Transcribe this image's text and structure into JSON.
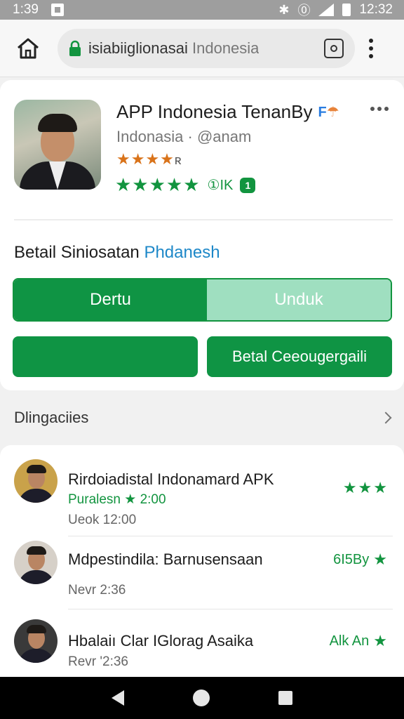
{
  "status_bar": {
    "time_left": "1:39",
    "time_right": "12:32"
  },
  "browser": {
    "url_main": "isiabiiglionasai",
    "url_domain": "Indonesia",
    "icons": [
      "home-icon",
      "lock-icon",
      "camera-icon",
      "more-vert-icon"
    ]
  },
  "app": {
    "title": "APP Indonesia TenanBy",
    "subtitle": "Indonasia · @anam",
    "orange_stars": "★★★★",
    "orange_suffix": "ʀ",
    "green_stars": "★★★★★",
    "count": "①IK",
    "badge": "1",
    "section_title_main": "Betail Siniosatan",
    "section_title_accent": "Phdanesh",
    "seg_left": "Dertu",
    "seg_right": "Unduk",
    "btn_left": "",
    "btn_right": "Betal Ceeougergaili",
    "colors": {
      "green": "#0f9444",
      "light_green": "#9fdfc0",
      "accent_blue": "#1e88c8",
      "orange": "#d9731a"
    }
  },
  "section": {
    "label": "Dlingaciies"
  },
  "list": [
    {
      "title": "Rirdoiadistal Indonamard APK",
      "meta": "Puralesn ★ 2:00",
      "time": "Ueok 12:00",
      "right_text": "",
      "right_stars": "★★★"
    },
    {
      "title": "Mdpestindila: Barnusensaan",
      "meta": "",
      "time": "Nevr 2:36",
      "right_text": "6I5By",
      "right_stars": "★"
    },
    {
      "title": "Hbalaiı Clar IGlorag Asaika",
      "meta": "",
      "time": "Revr '2:36",
      "right_text": "Alk An",
      "right_stars": "★"
    }
  ]
}
